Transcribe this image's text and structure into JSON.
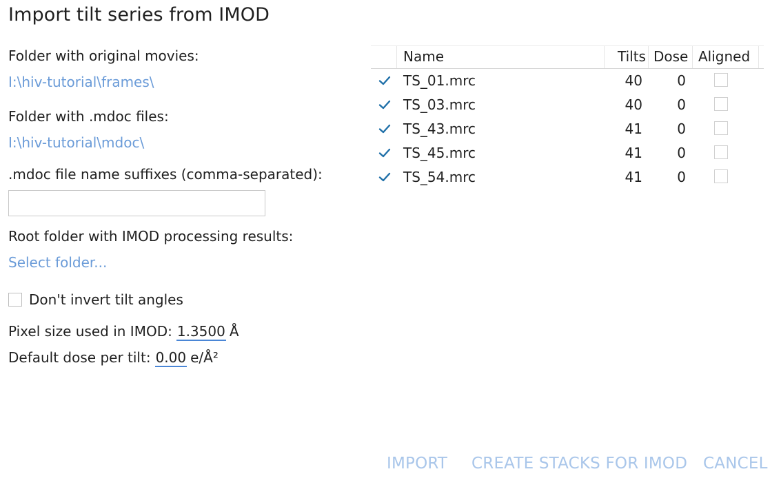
{
  "title": "Import tilt series from IMOD",
  "movies_folder": {
    "label": "Folder with original movies:",
    "value": "I:\\hiv-tutorial\\frames\\"
  },
  "mdoc_folder": {
    "label": "Folder with .mdoc files:",
    "value": "I:\\hiv-tutorial\\mdoc\\"
  },
  "suffixes": {
    "label": ".mdoc file name suffixes (comma-separated):",
    "value": "",
    "placeholder": ""
  },
  "imod_root": {
    "label": "Root folder with IMOD processing results:",
    "value": "Select folder..."
  },
  "invert": {
    "label": "Don't invert tilt angles",
    "checked": false
  },
  "pixel_size": {
    "label": "Pixel size used in IMOD:",
    "value": "1.3500",
    "unit": "Å"
  },
  "dose": {
    "label": "Default dose per tilt:",
    "value": "0.00",
    "unit": "e/Å²"
  },
  "table": {
    "headers": {
      "name": "Name",
      "tilts": "Tilts",
      "dose": "Dose",
      "aligned": "Aligned"
    },
    "rows": [
      {
        "checked": true,
        "name": "TS_01.mrc",
        "tilts": "40",
        "dose": "0",
        "aligned": false
      },
      {
        "checked": true,
        "name": "TS_03.mrc",
        "tilts": "40",
        "dose": "0",
        "aligned": false
      },
      {
        "checked": true,
        "name": "TS_43.mrc",
        "tilts": "41",
        "dose": "0",
        "aligned": false
      },
      {
        "checked": true,
        "name": "TS_45.mrc",
        "tilts": "41",
        "dose": "0",
        "aligned": false
      },
      {
        "checked": true,
        "name": "TS_54.mrc",
        "tilts": "41",
        "dose": "0",
        "aligned": false
      }
    ]
  },
  "buttons": {
    "import": "IMPORT",
    "create_stacks": "CREATE STACKS FOR IMOD",
    "cancel": "CANCEL"
  },
  "colors": {
    "link": "#6a9bd8",
    "accent": "#1e6fa8",
    "button_disabled": "#a9c6ea"
  }
}
